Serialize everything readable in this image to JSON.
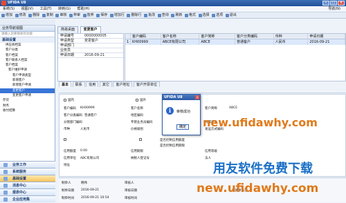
{
  "window": {
    "title": "UFIDA U8"
  },
  "menu": [
    "系统(S)",
    "视图(V)",
    "工具(T)",
    "转到(G)",
    "帮助(H)"
  ],
  "menu_right": "导航(N)",
  "toolbar": [
    "增加",
    "修改",
    "删除",
    "复制",
    "审核",
    "弃审",
    "放弃",
    "保存",
    "增加行",
    "删除行",
    "批改",
    "查询",
    "刷新",
    "格式",
    "选择",
    "选项",
    "退出"
  ],
  "sidebar": {
    "title": "业务导航视图",
    "search_placeholder": "请输入您要搜索的功能",
    "section": "基础设置",
    "tree": [
      "供应商档案",
      "客户分类",
      "客户档案",
      "客户联系人档案",
      "客户档案",
      "客户维护申请",
      "客户申请类型",
      "新增客户",
      "新增客户申请",
      "变更客户",
      "变更客户申请"
    ],
    "groups": [
      "存货",
      "财务",
      "收付结算"
    ],
    "nav": [
      "业务工作",
      "系统服务",
      "基础设置",
      "消息中心",
      "报表中心",
      "企业应用集"
    ]
  },
  "tabs": [
    "简易桌面",
    "变更客户"
  ],
  "list": {
    "fields": [
      {
        "label": "申请编号",
        "value": "0000000005"
      },
      {
        "label": "申请类型",
        "value": "变更客户"
      },
      {
        "label": "申请部门",
        "value": ""
      },
      {
        "label": "业务员",
        "value": ""
      },
      {
        "label": "申请日期",
        "value": "2016-09-21"
      }
    ]
  },
  "grid": {
    "headers": [
      "",
      "客户编码",
      "客户名称",
      "客户简称",
      "客户分类编码",
      "币种",
      "申请日期"
    ],
    "row": [
      "1",
      "KH00999",
      "ABCE有限公司",
      "ABCE",
      "普通客户",
      "人民币",
      "2016-09-21"
    ]
  },
  "subtabs": [
    "基本",
    "联系",
    "信用",
    "其它",
    "客户地址",
    "客户开票单位"
  ],
  "form": {
    "domestic_label": "国内",
    "foreign_label": "国外",
    "code_label": "客户编码",
    "code": "KH00999",
    "name_label": "客户名称",
    "short_label": "客户简称",
    "short": "ABCE",
    "class_label": "客户分类编码",
    "class": "普通客户",
    "region_label": "地区编码",
    "branch_label": "分管部门编码",
    "staff_label": "专管业务员编码",
    "industry_label": "所属行业",
    "currency_label": "币种",
    "currency": "人民币",
    "price_label": "价格级别",
    "ship_label": "发运方式编码",
    "credit_label": "是否控制信用额度",
    "credit_ctrl": "是否控制信用期限",
    "limit_label": "信用额度",
    "limit": "0.00",
    "term_label": "信用期限",
    "grade_label": "信用等级",
    "unit_label": "信用单位",
    "unit": "ABC有限公司",
    "tax_label": "纳税人登记号",
    "legal_label": "法人",
    "addr_label": "地址"
  },
  "dialog": {
    "title": "UFIDA U8",
    "message": "审核成功",
    "ok": "确定"
  },
  "footer": {
    "maker_label": "制单人",
    "maker": "韩伟",
    "make_date_label": "制单日期",
    "make_date": "2016-09-21",
    "make_time_label": "制单时间",
    "make_time": "2016-09-21 10:54",
    "audit_label": "审核人",
    "auditor": "韩伟",
    "audit_date_label": "审核日期",
    "audit_date": "2016-09-21",
    "audit_time_label": "审核时间",
    "audit_time": "2016-09-21 10:55",
    "status_label": "申请单备注"
  },
  "watermarks": {
    "url_top": "new.ufidawhy.com",
    "slogan": "用友软件免费下载",
    "url_bottom": "new.ufidawhy.com"
  }
}
